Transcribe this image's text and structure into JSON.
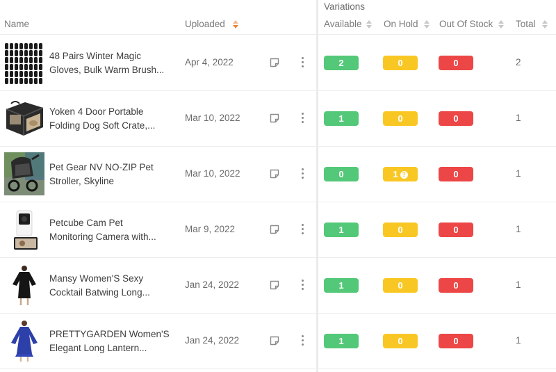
{
  "header": {
    "variations": "Variations",
    "name": "Name",
    "uploaded": "Uploaded",
    "available": "Available",
    "on_hold": "On Hold",
    "out_of_stock": "Out Of Stock",
    "total": "Total"
  },
  "colors": {
    "available": "#53c878",
    "on_hold": "#f9c723",
    "out_of_stock": "#ec4646",
    "sort_active": "#e8863a"
  },
  "rows": [
    {
      "name_line1": "48 Pairs Winter Magic",
      "name_line2": "Gloves, Bulk Warm Brush...",
      "date": "Apr 4, 2022",
      "available": "2",
      "on_hold": "0",
      "out_of_stock": "0",
      "total": "2",
      "thumb_icon": "gloves-thumbnail"
    },
    {
      "name_line1": "Yoken 4 Door Portable",
      "name_line2": "Folding Dog Soft Crate,...",
      "date": "Mar 10, 2022",
      "available": "1",
      "on_hold": "0",
      "out_of_stock": "0",
      "total": "1",
      "thumb_icon": "dog-crate-thumbnail"
    },
    {
      "name_line1": "Pet Gear NV NO-ZIP Pet",
      "name_line2": "Stroller, Skyline",
      "date": "Mar 10, 2022",
      "available": "0",
      "on_hold": "1",
      "on_hold_has_info": true,
      "out_of_stock": "0",
      "total": "1",
      "thumb_icon": "stroller-thumbnail"
    },
    {
      "name_line1": "Petcube Cam Pet",
      "name_line2": "Monitoring Camera with...",
      "date": "Mar 9, 2022",
      "available": "1",
      "on_hold": "0",
      "out_of_stock": "0",
      "total": "1",
      "thumb_icon": "camera-thumbnail"
    },
    {
      "name_line1": "Mansy Women'S Sexy",
      "name_line2": "Cocktail Batwing Long...",
      "date": "Jan 24, 2022",
      "available": "1",
      "on_hold": "0",
      "out_of_stock": "0",
      "total": "1",
      "thumb_icon": "black-dress-thumbnail"
    },
    {
      "name_line1": "PRETTYGARDEN Women'S",
      "name_line2": "Elegant Long Lantern...",
      "date": "Jan 24, 2022",
      "available": "1",
      "on_hold": "0",
      "out_of_stock": "0",
      "total": "1",
      "thumb_icon": "blue-dress-thumbnail"
    }
  ]
}
